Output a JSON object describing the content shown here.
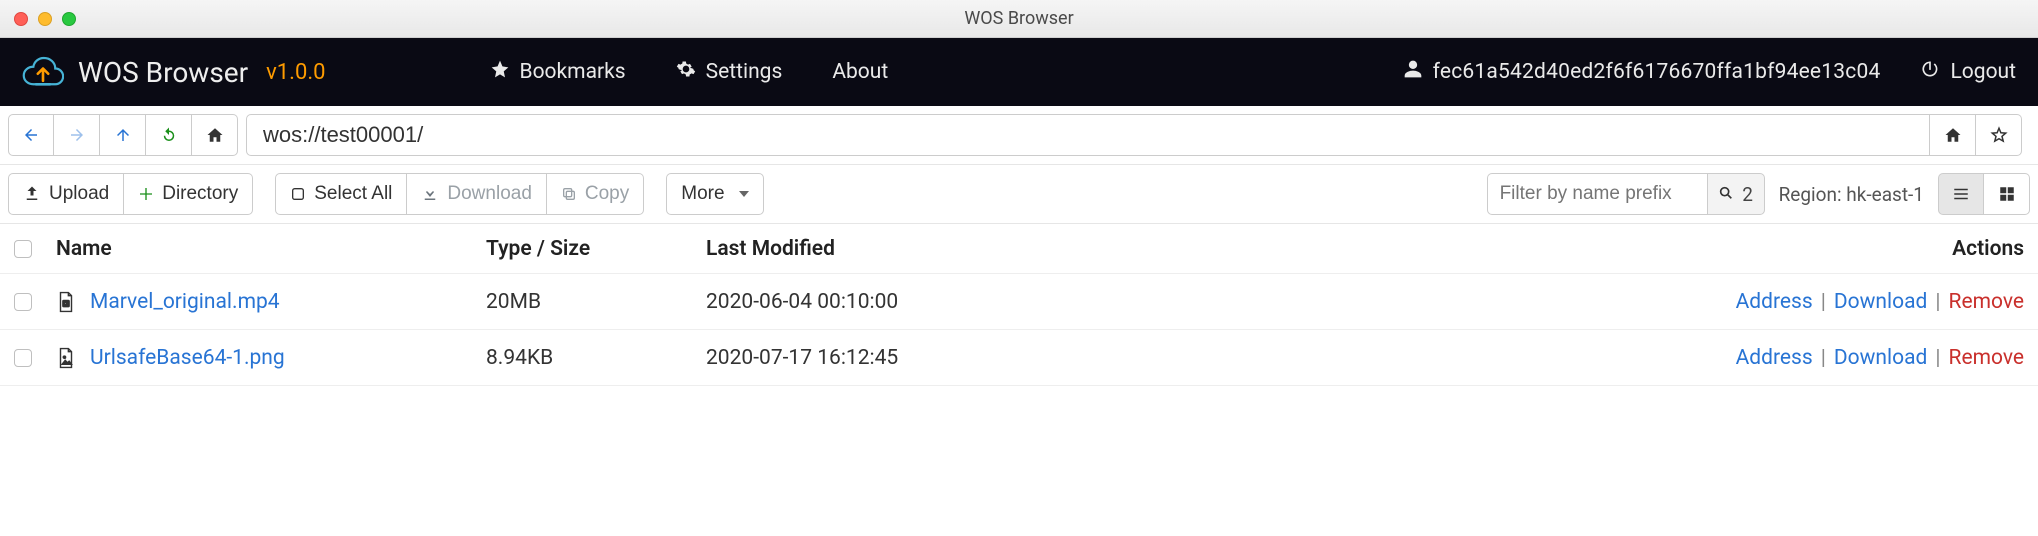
{
  "window": {
    "title": "WOS Browser"
  },
  "app": {
    "name": "WOS Browser",
    "version": "v1.0.0",
    "nav": {
      "bookmarks": "Bookmarks",
      "settings": "Settings",
      "about": "About",
      "logout": "Logout"
    },
    "user_hash": "fec61a542d40ed2f6f6176670ffa1bf94ee13c04"
  },
  "address": {
    "url": "wos://test00001/"
  },
  "toolbar": {
    "upload": "Upload",
    "directory": "Directory",
    "select_all": "Select All",
    "download": "Download",
    "copy": "Copy",
    "more": "More",
    "filter_placeholder": "Filter by name prefix",
    "result_count": "2",
    "region_label": "Region: ",
    "region_value": "hk-east-1"
  },
  "table": {
    "headers": {
      "name": "Name",
      "type_size": "Type / Size",
      "last_modified": "Last Modified",
      "actions": "Actions"
    },
    "action_labels": {
      "address": "Address",
      "download": "Download",
      "remove": "Remove"
    },
    "rows": [
      {
        "name": "Marvel_original.mp4",
        "type_size": "20MB",
        "last_modified": "2020-06-04 00:10:00",
        "icon": "video"
      },
      {
        "name": "UrlsafeBase64-1.png",
        "type_size": "8.94KB",
        "last_modified": "2020-07-17 16:12:45",
        "icon": "image"
      }
    ]
  }
}
